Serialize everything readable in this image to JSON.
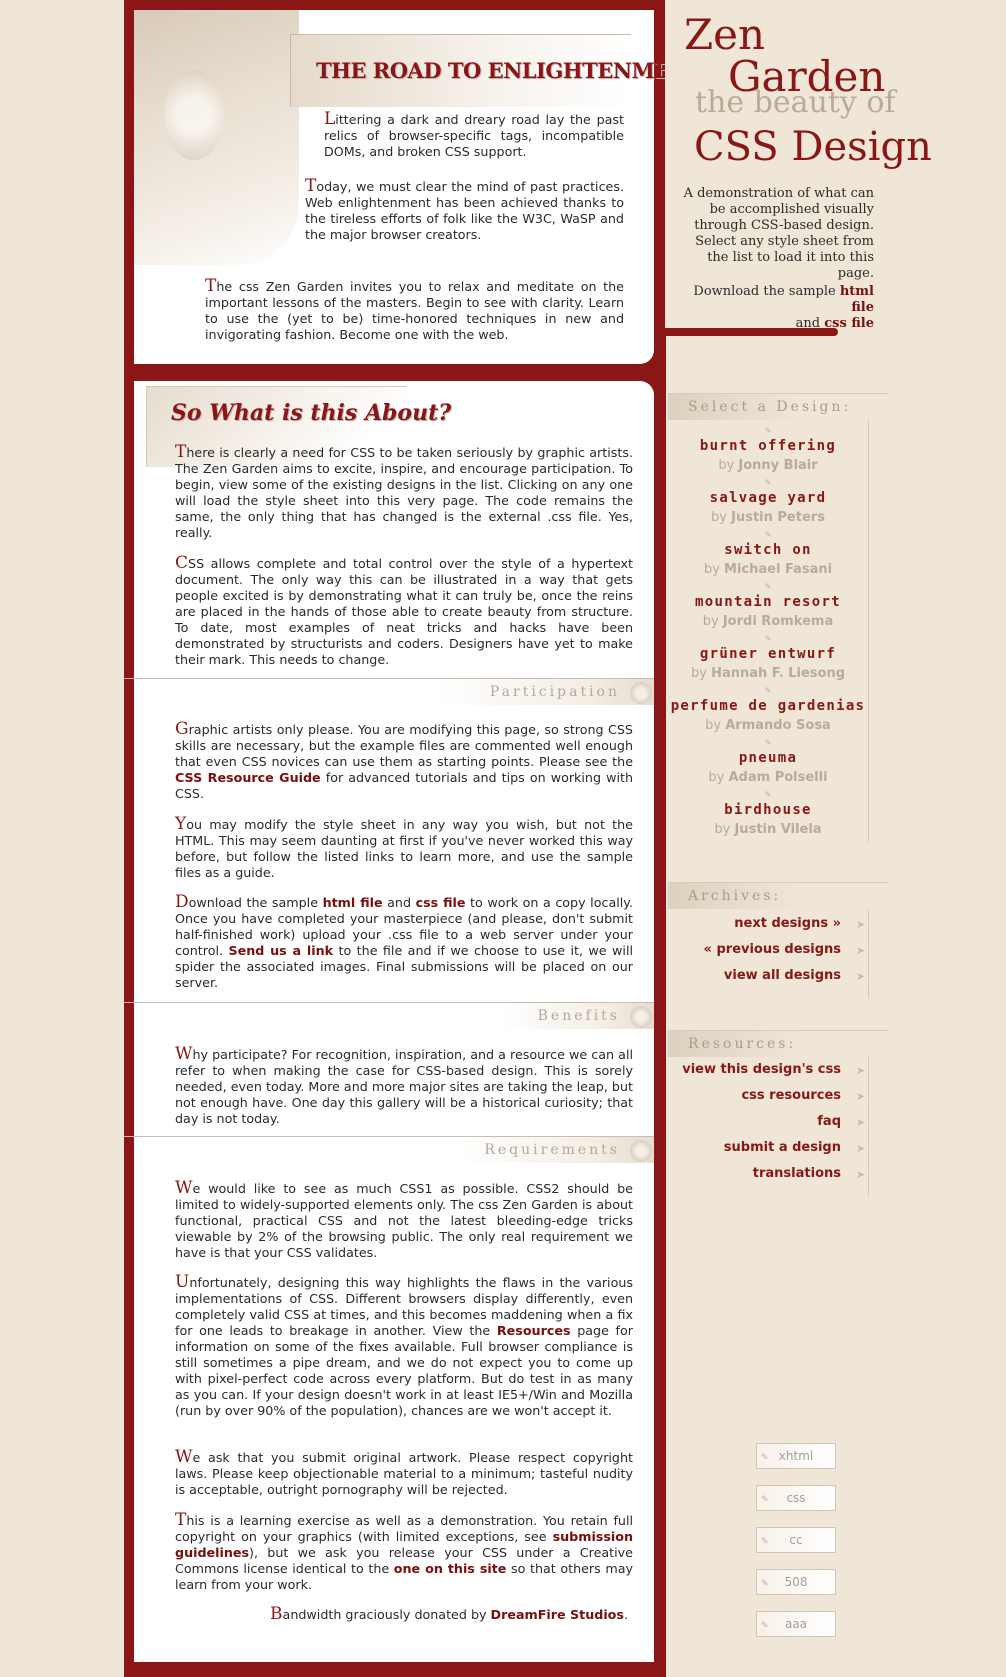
{
  "intro": {
    "title": "THE ROAD TO ENLIGHTENMENT",
    "p1_cap": "L",
    "p1": "ittering a dark and dreary road lay the past relics of browser-specific tags, incompatible DOMs, and broken CSS support.",
    "p2_cap": "T",
    "p2": "oday, we must clear the mind of past practices. Web enlightenment has been achieved thanks to the tireless efforts of folk like the W3C, WaSP and the major browser creators.",
    "p3_cap": "T",
    "p3": "he css Zen Garden invites you to relax and meditate on the important lessons of the masters. Begin to see with clarity. Learn to use the (yet to be) time-honored techniques in new and invigorating fashion. Become one with the web."
  },
  "about": {
    "title": "So What is this About?",
    "p1_cap": "T",
    "p1": "here is clearly a need for CSS to be taken seriously by graphic artists. The Zen Garden aims to excite, inspire, and encourage participation. To begin, view some of the existing designs in the list. Clicking on any one will load the style sheet into this very page. The code remains the same, the only thing that has changed is the external .css file. Yes, really.",
    "p2_cap": "C",
    "p2": "SS allows complete and total control over the style of a hypertext document. The only way this can be illustrated in a way that gets people excited is by demonstrating what it can truly be, once the reins are placed in the hands of those able to create beauty from structure. To date, most examples of neat tricks and hacks have been demonstrated by structurists and coders. Designers have yet to make their mark. This needs to change."
  },
  "participation": {
    "title": "Participation",
    "p1_cap": "G",
    "p1_a": "raphic artists only please. You are modifying this page, so strong CSS skills are necessary, but the example files are commented well enough that even CSS novices can use them as starting points. Please see the ",
    "p1_link": "CSS Resource Guide",
    "p1_b": " for advanced tutorials and tips on working with CSS.",
    "p2_cap": "Y",
    "p2": "ou may modify the style sheet in any way you wish, but not the HTML. This may seem daunting at first if you've never worked this way before, but follow the listed links to learn more, and use the sample files as a guide.",
    "p3_cap": "D",
    "p3_a": "ownload the sample ",
    "p3_link1": "html file",
    "p3_b": " and ",
    "p3_link2": "css file",
    "p3_c": " to work on a copy locally. Once you have completed your masterpiece (and please, don't submit half-finished work) upload your .css file to a web server under your control. ",
    "p3_link3": "Send us a link",
    "p3_d": " to the file and if we choose to use it, we will spider the associated images. Final submissions will be placed on our server."
  },
  "benefits": {
    "title": "Benefits",
    "p1_cap": "W",
    "p1": "hy participate? For recognition, inspiration, and a resource we can all refer to when making the case for CSS-based design. This is sorely needed, even today. More and more major sites are taking the leap, but not enough have. One day this gallery will be a historical curiosity; that day is not today."
  },
  "requirements": {
    "title": "Requirements",
    "p1_cap": "W",
    "p1": "e would like to see as much CSS1 as possible. CSS2 should be limited to widely-supported elements only. The css Zen Garden is about functional, practical CSS and not the latest bleeding-edge tricks viewable by 2% of the browsing public. The only real requirement we have is that your CSS validates.",
    "p2_cap": "U",
    "p2_a": "nfortunately, designing this way highlights the flaws in the various implementations of CSS. Different browsers display differently, even completely valid CSS at times, and this becomes maddening when a fix for one leads to breakage in another. View the ",
    "p2_link": "Resources",
    "p2_b": " page for information on some of the fixes available. Full browser compliance is still sometimes a pipe dream, and we do not expect you to come up with pixel-perfect code across every platform. But do test in as many as you can. If your design doesn't work in at least IE5+/Win and Mozilla (run by over 90% of the population), chances are we won't accept it.",
    "p3_cap": "W",
    "p3": "e ask that you submit original artwork. Please respect copyright laws. Please keep objectionable material to a minimum; tasteful nudity is acceptable, outright pornography will be rejected.",
    "p4_cap": "T",
    "p4_a": "his is a learning exercise as well as a demonstration. You retain full copyright on your graphics (with limited exceptions, see ",
    "p4_link1": "submission guidelines",
    "p4_b": "), but we ask you release your CSS under a Creative Commons license identical to the ",
    "p4_link2": "one on this site",
    "p4_c": " so that others may learn from your work.",
    "footer_cap": "B",
    "footer_a": "andwidth graciously donated by ",
    "footer_link": "DreamFire Studios",
    "footer_b": "."
  },
  "header": {
    "zen": "Zen",
    "garden": "Garden",
    "beauty": "the beauty of",
    "css_design": "CSS Design",
    "desc": "A demonstration of what can be accomplished visually through CSS-based design. Select any style sheet from the list to load it into this page.",
    "download_a": "Download the sample ",
    "download_html": "html file",
    "download_and": "and ",
    "download_css": "css file"
  },
  "select": {
    "title": "Select a Design:",
    "by": "by",
    "designs": [
      {
        "name": "burnt offering",
        "author": "Jonny Blair"
      },
      {
        "name": "salvage yard",
        "author": "Justin Peters"
      },
      {
        "name": "switch on",
        "author": "Michael Fasani"
      },
      {
        "name": "mountain resort",
        "author": "Jordi Romkema"
      },
      {
        "name": "grüner entwurf",
        "author": "Hannah F. Liesong"
      },
      {
        "name": "perfume de gardenias",
        "author": "Armando Sosa"
      },
      {
        "name": "pneuma",
        "author": "Adam Polselli"
      },
      {
        "name": "birdhouse",
        "author": "Justin Vilela"
      }
    ]
  },
  "archives": {
    "title": "Archives:",
    "links": [
      "next designs »",
      "« previous designs",
      "view all designs"
    ]
  },
  "resources": {
    "title": "Resources:",
    "links": [
      "view this design's css",
      "css resources",
      "faq",
      "submit a design",
      "translations"
    ]
  },
  "badges": [
    "xhtml",
    "css",
    "cc",
    "508",
    "aaa"
  ],
  "colors": {
    "accent": "#8b1616",
    "background": "#efe6d8"
  }
}
